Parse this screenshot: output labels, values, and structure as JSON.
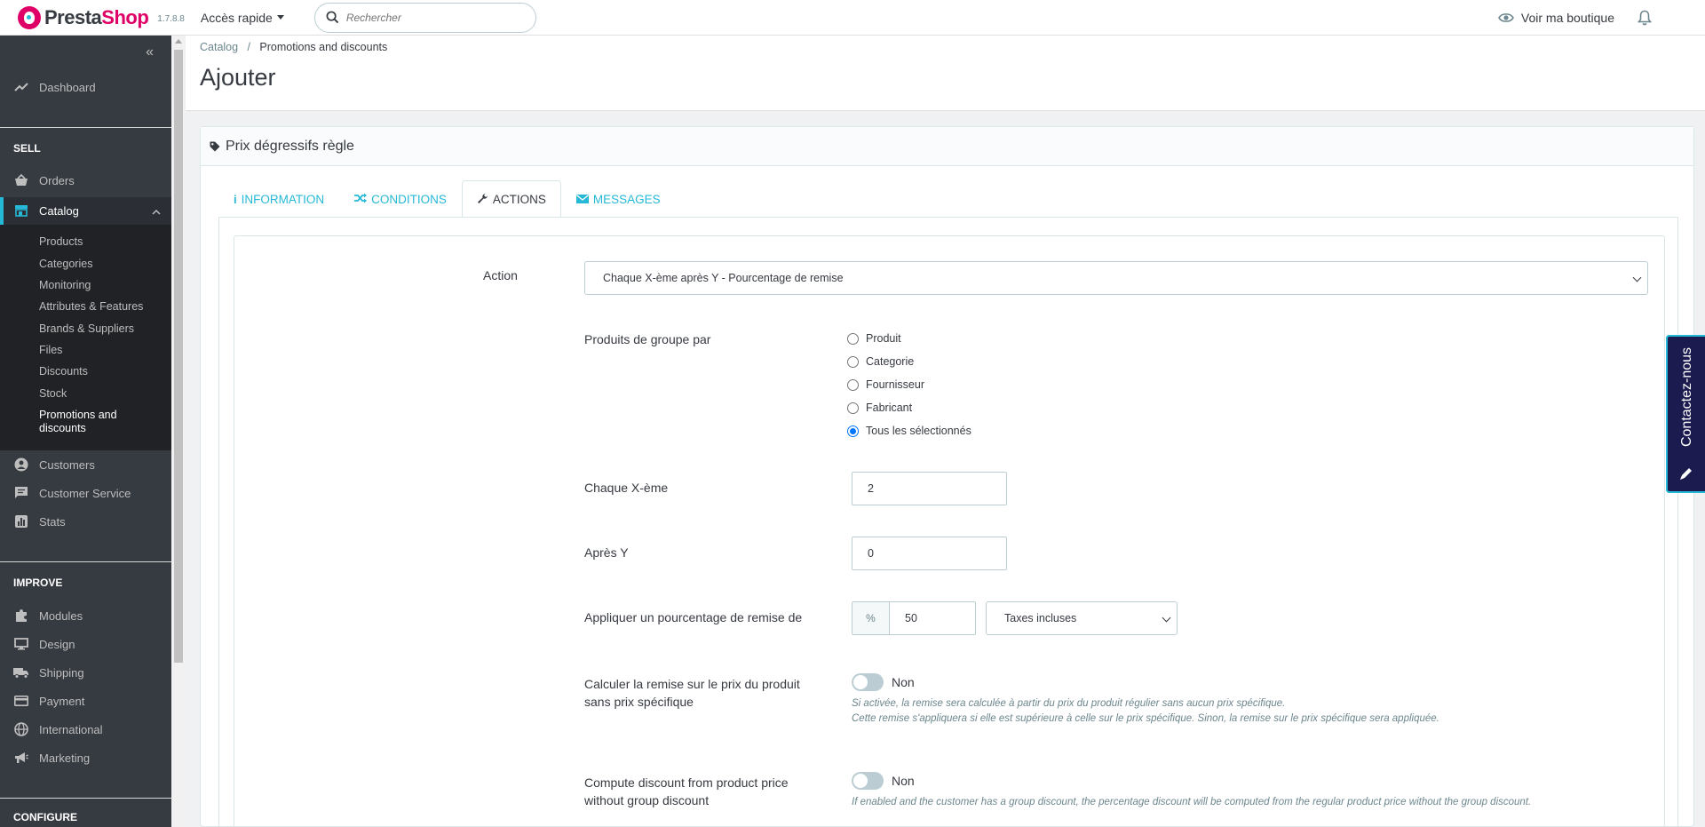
{
  "header": {
    "logo_text_dark": "Presta",
    "logo_text_pink": "Shop",
    "version": "1.7.8.8",
    "quick_access": "Accès rapide",
    "search_placeholder": "Rechercher",
    "view_shop": "Voir ma boutique"
  },
  "sidebar": {
    "dashboard": "Dashboard",
    "sell_title": "SELL",
    "orders": "Orders",
    "catalog": "Catalog",
    "catalog_items": [
      "Products",
      "Categories",
      "Monitoring",
      "Attributes & Features",
      "Brands & Suppliers",
      "Files",
      "Discounts",
      "Stock",
      "Promotions and discounts"
    ],
    "customers": "Customers",
    "customer_service": "Customer Service",
    "stats": "Stats",
    "improve_title": "IMPROVE",
    "modules": "Modules",
    "design": "Design",
    "shipping": "Shipping",
    "payment": "Payment",
    "international": "International",
    "marketing": "Marketing",
    "configure_title": "CONFIGURE"
  },
  "page": {
    "breadcrumb_parent": "Catalog",
    "breadcrumb_sep": "/",
    "breadcrumb_current": "Promotions and discounts",
    "title": "Ajouter"
  },
  "panel": {
    "title": "Prix dégressifs règle",
    "tabs": [
      "INFORMATION",
      "CONDITIONS",
      "ACTIONS",
      "MESSAGES"
    ],
    "active_tab": "ACTIONS"
  },
  "form": {
    "action_label": "Action",
    "action_value": "Chaque X-ème après Y - Pourcentage de remise",
    "group_label": "Produits de groupe par",
    "group_options": [
      "Produit",
      "Categorie",
      "Fournisseur",
      "Fabricant",
      "Tous les sélectionnés"
    ],
    "group_selected": "Tous les sélectionnés",
    "every_x_label": "Chaque X-ème",
    "every_x_value": "2",
    "after_y_label": "Après Y",
    "after_y_value": "0",
    "percent_label": "Appliquer un pourcentage de remise de",
    "percent_addon": "%",
    "percent_value": "50",
    "tax_value": "Taxes incluses",
    "no_specific_label": "Calculer la remise sur le prix du produit sans prix spécifique",
    "no_specific_state": "Non",
    "no_specific_help_1": "Si activée, la remise sera calculée à partir du prix du produit régulier sans aucun prix spécifique.",
    "no_specific_help_2": "Cette remise s'appliquera si elle est supérieure à celle sur le prix spécifique. Sinon, la remise sur le prix spécifique sera appliquée.",
    "group_discount_label": "Compute discount from product price without group discount",
    "group_discount_state": "Non",
    "group_discount_help": "If enabled and the customer has a group discount, the percentage discount will be computed from the regular product price without the group discount."
  },
  "contact": {
    "label": "Contactez-nous"
  },
  "colors": {
    "brand_pink": "#df0067",
    "accent_cyan": "#25b9d7",
    "sidebar_bg": "#363a41",
    "contact_bg": "#1b1b4f"
  }
}
